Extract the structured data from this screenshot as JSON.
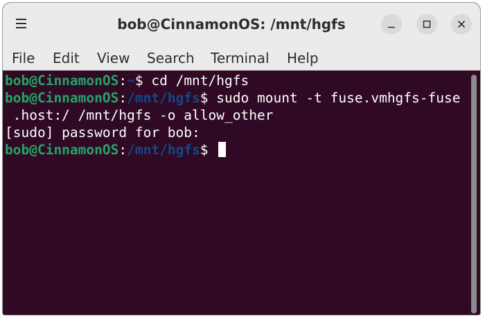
{
  "window": {
    "title": "bob@CinnamonOS: /mnt/hgfs",
    "menu_icon": "hamburger-menu-icon",
    "buttons": {
      "minimize_icon": "minimize-icon",
      "maximize_icon": "maximize-icon",
      "close_icon": "close-icon"
    }
  },
  "menu": {
    "items": [
      "File",
      "Edit",
      "View",
      "Search",
      "Terminal",
      "Help"
    ]
  },
  "terminal": {
    "colors": {
      "background": "#300a24",
      "user_host": "#26a269",
      "path": "#12488b",
      "text": "#ffffff"
    },
    "lines": [
      {
        "user": "bob@CinnamonOS",
        "colon": ":",
        "path": "~",
        "command": "$ cd /mnt/hgfs"
      },
      {
        "user": "bob@CinnamonOS",
        "colon": ":",
        "path": "/mnt/hgfs",
        "command": "$ sudo mount -t fuse.vmhgfs-fuse"
      },
      {
        "text": " .host:/ /mnt/hgfs -o allow_other"
      },
      {
        "text": "[sudo] password for bob:"
      },
      {
        "user": "bob@CinnamonOS",
        "colon": ":",
        "path": "/mnt/hgfs",
        "command": "$ "
      }
    ]
  }
}
